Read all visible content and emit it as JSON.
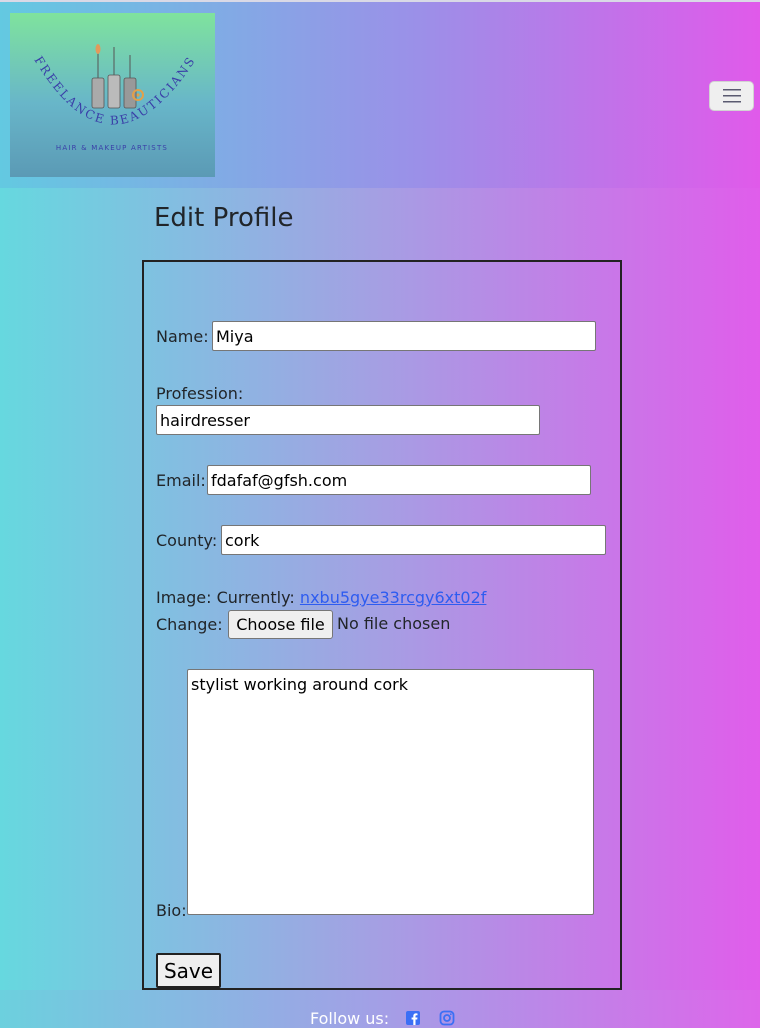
{
  "brand": {
    "logo_top": "FREELANCE BEAUTICIANS",
    "logo_sub": "HAIR & MAKEUP ARTISTS"
  },
  "page": {
    "title": "Edit Profile"
  },
  "form": {
    "name_label": "Name:",
    "name_value": "Miya",
    "profession_label": "Profession:",
    "profession_value": "hairdresser",
    "email_label": "Email:",
    "email_value": "fdafaf@gfsh.com",
    "county_label": "County:",
    "county_value": "cork",
    "image_label": "Image: Currently:",
    "image_current": "nxbu5gye33rcgy6xt02f",
    "change_label": "Change:",
    "choose_file_label": "Choose file",
    "no_file_text": "No file chosen",
    "bio_label": "Bio:",
    "bio_value": "stylist working around cork",
    "save_label": "Save"
  },
  "footer": {
    "follow_label": "Follow us:",
    "icons": [
      "facebook-icon",
      "instagram-icon"
    ]
  },
  "colors": {
    "link": "#2e5cf0",
    "social": "#3b6ff5"
  }
}
